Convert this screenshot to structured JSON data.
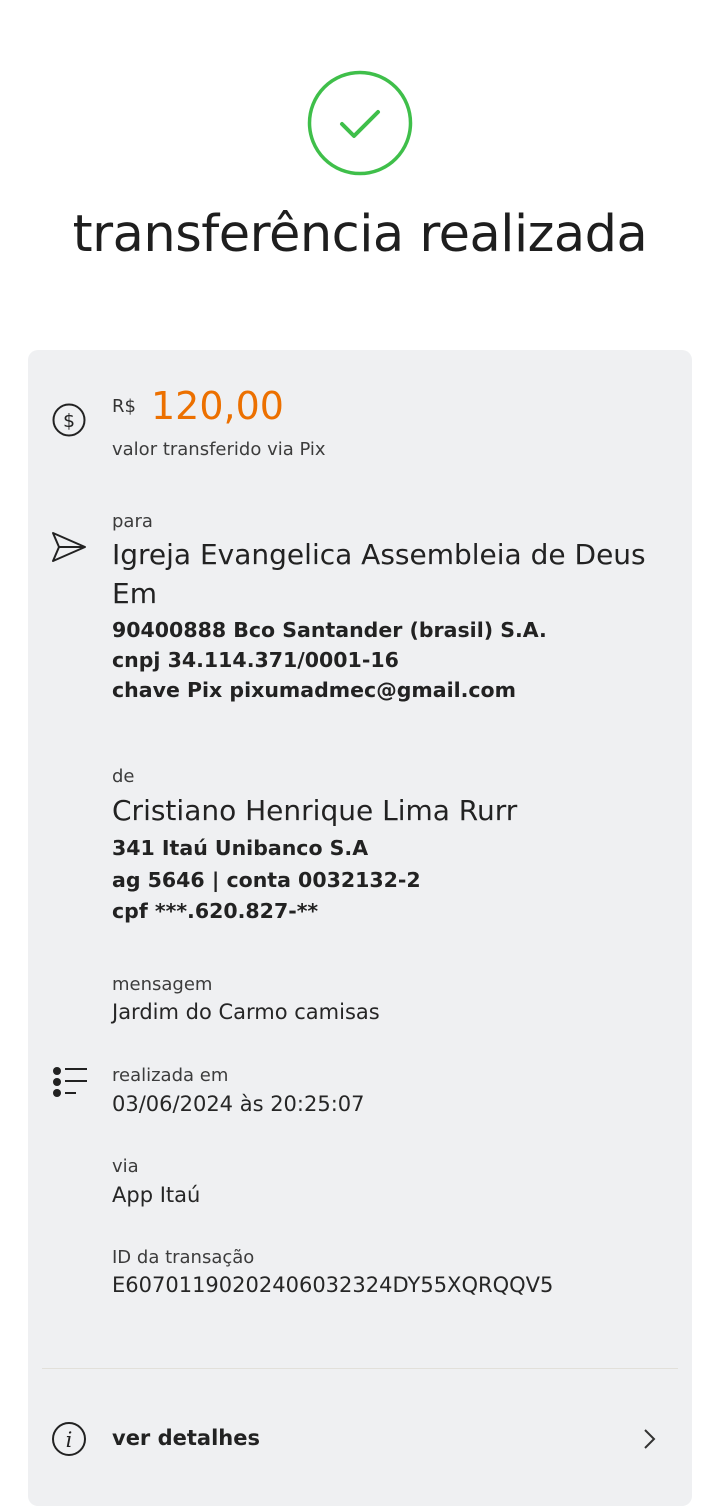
{
  "status": {
    "icon": "check-circle-icon",
    "title": "transferência realizada",
    "accent_color": "#3fbf4a"
  },
  "amount": {
    "currency": "R$",
    "value": "120,00",
    "caption": "valor transferido via Pix",
    "color": "#ec7000",
    "icon": "dollar-circle-icon"
  },
  "recipient": {
    "icon": "send-icon",
    "label": "para",
    "name_line1": "Igreja Evangelica Assembleia de Deus",
    "name_line2": "Em",
    "bank": "90400888 Bco Santander (brasil) S.A.",
    "document": "cnpj 34.114.371/0001-16",
    "pix_key": "chave Pix pixumadmec@gmail.com"
  },
  "sender": {
    "label": "de",
    "name": "Cristiano Henrique Lima Rurr",
    "bank": "341 Itaú Unibanco S.A",
    "account": "ag 5646 | conta 0032132-2",
    "document": "cpf ***.620.827-**"
  },
  "message": {
    "label": "mensagem",
    "value": "Jardim do Carmo  camisas"
  },
  "details": {
    "icon": "list-icon",
    "date_label": "realizada em",
    "date_value": "03/06/2024 às 20:25:07",
    "via_label": "via",
    "via_value": "App Itaú",
    "id_label": "ID da transação",
    "id_value": "E60701190202406032324DY55XQRQQV5"
  },
  "footer": {
    "info_icon": "info-icon",
    "label": "ver detalhes",
    "chevron_icon": "chevron-right-icon"
  }
}
